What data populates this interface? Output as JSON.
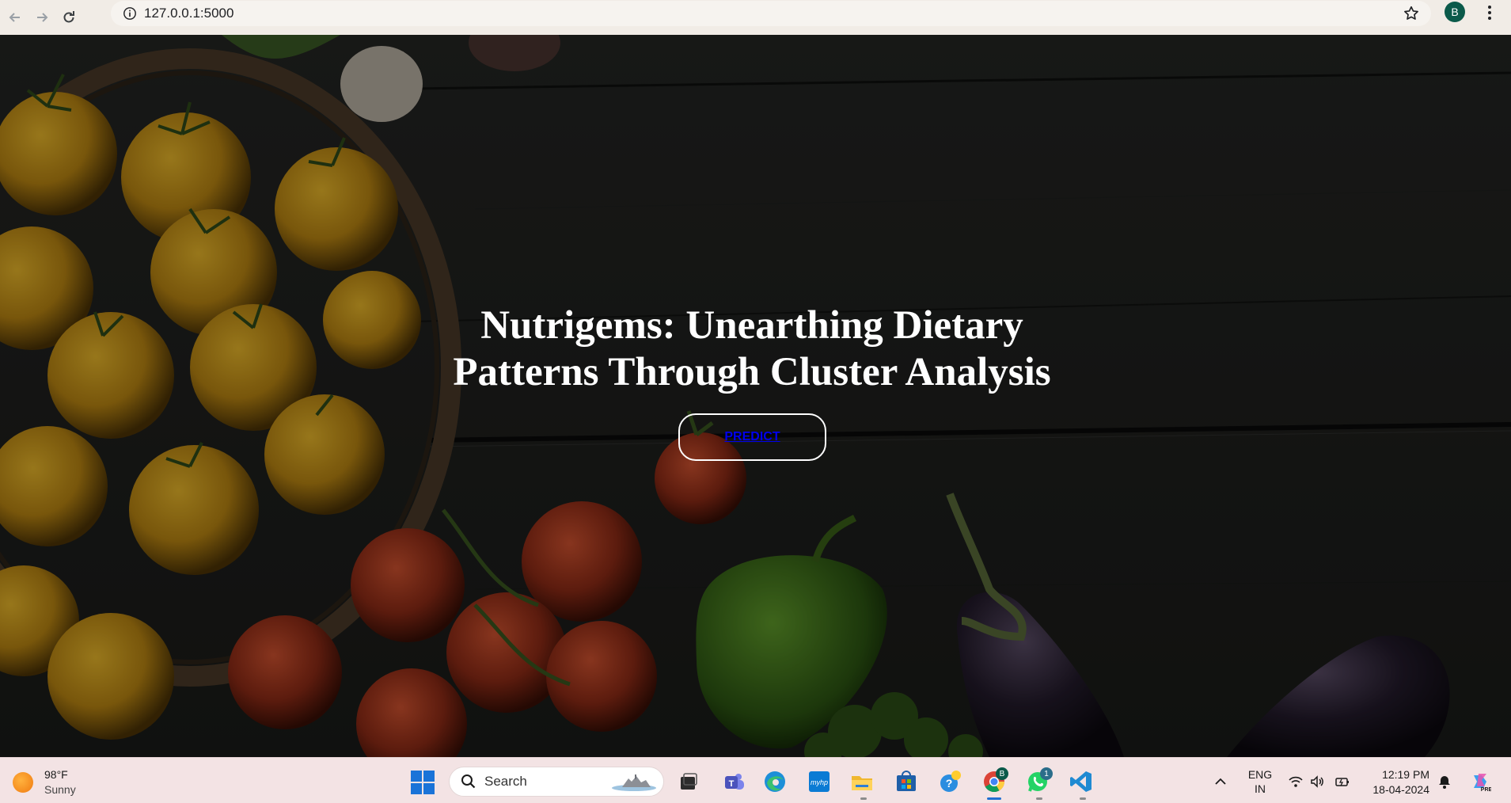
{
  "browser": {
    "url": "127.0.0.1:5000",
    "avatar_initial": "B",
    "icons": [
      "back-icon",
      "forward-icon",
      "reload-icon",
      "info-icon",
      "star-icon",
      "kebab-menu-icon"
    ]
  },
  "hero": {
    "title": "Nutrigems: Unearthing Dietary Patterns Through Cluster Analysis",
    "button_label": "PREDICT"
  },
  "taskbar": {
    "weather_temp": "98°F",
    "weather_condition": "Sunny",
    "search_placeholder": "Search",
    "language_line1": "ENG",
    "language_line2": "IN",
    "time": "12:19 PM",
    "date": "18-04-2024",
    "whatsapp_badge": "1",
    "chrome_badge": "B",
    "apps": [
      "start",
      "search",
      "task-view",
      "teams",
      "edge",
      "myhp",
      "file-explorer",
      "microsoft-store",
      "tips",
      "chrome",
      "whatsapp",
      "vscode"
    ]
  },
  "colors": {
    "chrome_bg": "#f1ece6",
    "page_bg": "#1c1d1b",
    "title_color": "#ffffff",
    "link_color": "#0000ee",
    "taskbar_bg": "#f3e3e4"
  }
}
